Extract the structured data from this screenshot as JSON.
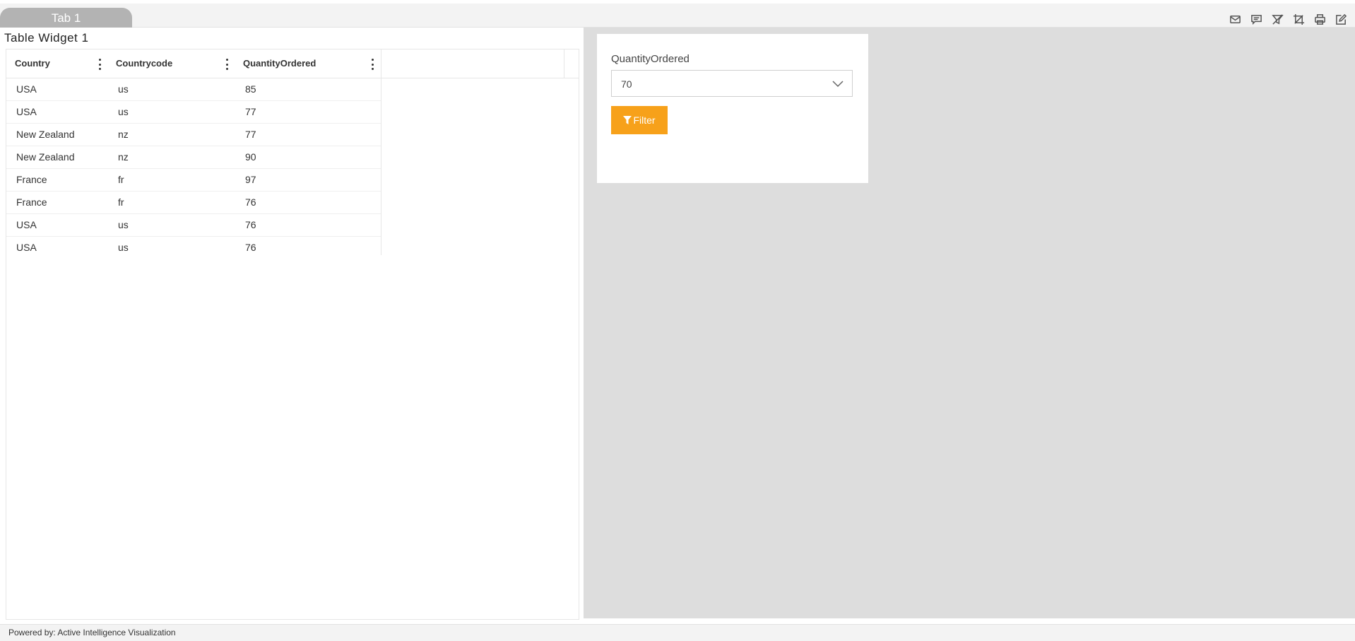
{
  "tabs": [
    {
      "label": "Tab 1"
    }
  ],
  "toolbar": {
    "icons": [
      "mail-icon",
      "comment-icon",
      "clear-filter-icon",
      "crop-icon",
      "print-icon",
      "edit-icon"
    ]
  },
  "table_widget": {
    "title": "Table Widget 1",
    "columns": [
      "Country",
      "Countrycode",
      "QuantityOrdered"
    ],
    "rows": [
      [
        "USA",
        "us",
        "85"
      ],
      [
        "USA",
        "us",
        "77"
      ],
      [
        "New Zealand",
        "nz",
        "77"
      ],
      [
        "New Zealand",
        "nz",
        "90"
      ],
      [
        "France",
        "fr",
        "97"
      ],
      [
        "France",
        "fr",
        "76"
      ],
      [
        "USA",
        "us",
        "76"
      ],
      [
        "USA",
        "us",
        "76"
      ]
    ]
  },
  "filter_widget": {
    "label": "QuantityOrdered",
    "selected_value": "70",
    "button_label": "Filter"
  },
  "footer": {
    "text": "Powered by: Active Intelligence Visualization"
  },
  "colors": {
    "accent": "#f7a11a",
    "canvas": "#dddddd",
    "tab": "#b3b3b3"
  }
}
